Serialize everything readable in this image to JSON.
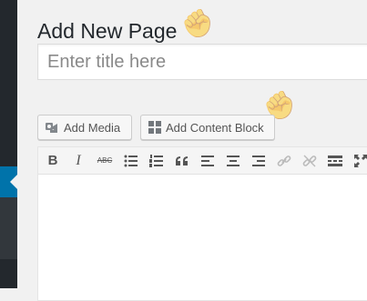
{
  "page": {
    "title": "Add New Page",
    "title_placeholder": "Enter title here"
  },
  "media_buttons": {
    "add_media": "Add Media",
    "add_content_block": "Add Content Block"
  },
  "toolbar": {
    "bold": "B",
    "italic": "I",
    "strikethrough": "ABC"
  },
  "colors": {
    "admin_bar": "#23282d",
    "admin_submenu": "#32373c",
    "current_item": "#0073aa"
  }
}
